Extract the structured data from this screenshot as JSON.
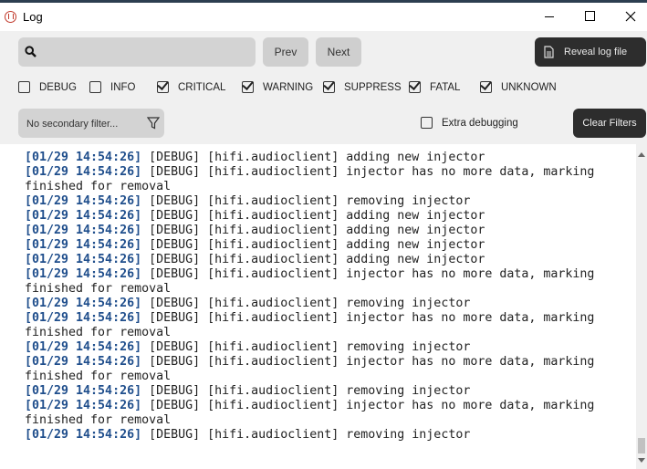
{
  "window": {
    "title": "Log",
    "app_icon": "hifi-logo-icon",
    "controls": [
      "minimize-icon",
      "maximize-icon",
      "close-icon"
    ]
  },
  "toolbar": {
    "search": {
      "icon": "search-icon",
      "value": "",
      "placeholder": ""
    },
    "prev_label": "Prev",
    "next_label": "Next",
    "reveal_label": "Reveal log file",
    "reveal_icon": "document-icon"
  },
  "filters": [
    {
      "label": "DEBUG",
      "checked": false
    },
    {
      "label": "INFO",
      "checked": false
    },
    {
      "label": "CRITICAL",
      "checked": true
    },
    {
      "label": "WARNING",
      "checked": true
    },
    {
      "label": "SUPPRESS",
      "checked": true
    },
    {
      "label": "FATAL",
      "checked": true
    },
    {
      "label": "UNKNOWN",
      "checked": true
    }
  ],
  "secondary_filter": {
    "placeholder": "No secondary filter...",
    "value": "",
    "icon": "funnel-icon"
  },
  "extra_debugging": {
    "label": "Extra debugging",
    "checked": false
  },
  "clear_filters_label": "Clear Filters",
  "colors": {
    "timestamp": "#1f4e8c",
    "dark_button": "#2d2d2d",
    "panel": "#f0f0f0"
  },
  "log": [
    {
      "ts": "[01/29 14:54:26]",
      "text": " [DEBUG] [hifi.audioclient] adding new injector"
    },
    {
      "ts": "[01/29 14:54:26]",
      "text": " [DEBUG] [hifi.audioclient] injector has no more data, marking finished for removal"
    },
    {
      "ts": "[01/29 14:54:26]",
      "text": " [DEBUG] [hifi.audioclient] removing injector"
    },
    {
      "ts": "[01/29 14:54:26]",
      "text": " [DEBUG] [hifi.audioclient] adding new injector"
    },
    {
      "ts": "[01/29 14:54:26]",
      "text": " [DEBUG] [hifi.audioclient] adding new injector"
    },
    {
      "ts": "[01/29 14:54:26]",
      "text": " [DEBUG] [hifi.audioclient] adding new injector"
    },
    {
      "ts": "[01/29 14:54:26]",
      "text": " [DEBUG] [hifi.audioclient] adding new injector"
    },
    {
      "ts": "[01/29 14:54:26]",
      "text": " [DEBUG] [hifi.audioclient] injector has no more data, marking finished for removal"
    },
    {
      "ts": "[01/29 14:54:26]",
      "text": " [DEBUG] [hifi.audioclient] removing injector"
    },
    {
      "ts": "[01/29 14:54:26]",
      "text": " [DEBUG] [hifi.audioclient] injector has no more data, marking finished for removal"
    },
    {
      "ts": "[01/29 14:54:26]",
      "text": " [DEBUG] [hifi.audioclient] removing injector"
    },
    {
      "ts": "[01/29 14:54:26]",
      "text": " [DEBUG] [hifi.audioclient] injector has no more data, marking finished for removal"
    },
    {
      "ts": "[01/29 14:54:26]",
      "text": " [DEBUG] [hifi.audioclient] removing injector"
    },
    {
      "ts": "[01/29 14:54:26]",
      "text": " [DEBUG] [hifi.audioclient] injector has no more data, marking finished for removal"
    },
    {
      "ts": "[01/29 14:54:26]",
      "text": " [DEBUG] [hifi.audioclient] removing injector"
    }
  ]
}
